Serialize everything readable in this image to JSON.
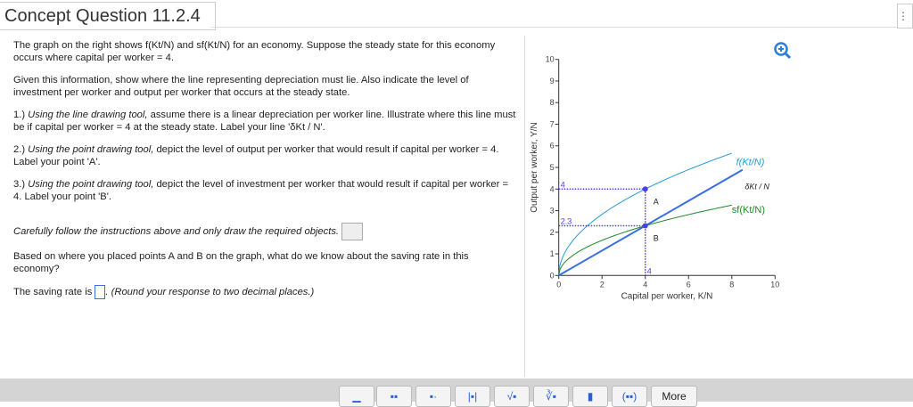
{
  "title": "Concept Question 11.2.4",
  "question": {
    "p1": "The graph on the right shows f(Kt/N) and sf(Kt/N) for an economy. Suppose the steady state for this economy occurs where capital per worker = 4.",
    "p2": "Given this information, show where the line representing depreciation must lie. Also indicate the level of investment per worker and output per worker that occurs at the steady state.",
    "p3_italic": "Using the line drawing tool,",
    "p3_num": "1.)",
    "p3": "assume there is a linear depreciation per worker line. Illustrate where this line must be if capital per worker = 4 at the steady state. Label your line 'δKt / N'.",
    "p4_num": "2.)",
    "p4_italic": "Using the point drawing tool,",
    "p4": "depict the level of output per worker that would result if capital per worker = 4. Label your point 'A'.",
    "p5_num": "3.)",
    "p5_italic": "Using the point drawing tool,",
    "p5": "depict the level of investment per worker that would result if capital per worker = 4. Label your point 'B'.",
    "p6": "Carefully follow the instructions above and only draw the required objects.",
    "p7": "Based on where you placed points A and B on the graph, what do we know about the saving rate in this economy?",
    "p8_pre": "The saving rate is",
    "p8_post": ". (Round your response to two decimal places.)"
  },
  "toolbar": [
    "▁",
    "▪▪",
    "▪·",
    "|▪|",
    "√▪",
    "∛▪",
    "▮",
    "(▪▪)",
    "More"
  ],
  "chart_data": {
    "type": "line",
    "xlabel": "Capital per worker, K/N",
    "ylabel": "Output per worker, Y/N",
    "xlim": [
      0,
      10
    ],
    "ylim": [
      0,
      10
    ],
    "xticks": [
      0,
      2,
      4,
      6,
      8,
      10
    ],
    "yticks": [
      0,
      1,
      2,
      3,
      4,
      5,
      6,
      7,
      8,
      9,
      10
    ],
    "series": [
      {
        "name": "f(Kt/N)",
        "color": "#2a9bd6",
        "formula": "2*sqrt(k)",
        "x_range": [
          0,
          8
        ]
      },
      {
        "name": "sf(Kt/N)",
        "color": "#1e8a2a",
        "formula": "1.15*sqrt(k)",
        "x_range": [
          0,
          8
        ]
      },
      {
        "name": "δKt / N",
        "color": "#3a6fe0",
        "points": [
          [
            0,
            0
          ],
          [
            8.5,
            4.89
          ]
        ]
      }
    ],
    "points": [
      {
        "label": "A",
        "x": 4,
        "y": 4
      },
      {
        "label": "B",
        "x": 4,
        "y": 2.3
      }
    ],
    "guide_labels": {
      "y_A": "4",
      "y_B": "2.3",
      "x": "4"
    }
  }
}
